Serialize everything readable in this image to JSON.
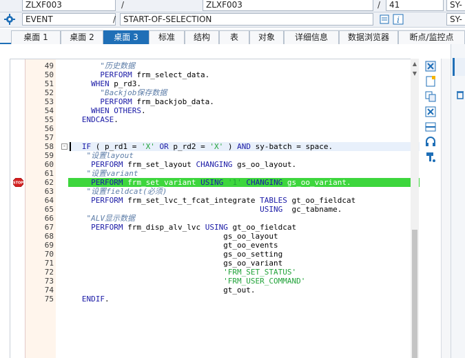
{
  "header": {
    "row1": {
      "program": "ZLXF003",
      "include": "ZLXF003",
      "line": "41",
      "sysvar": "SY-"
    },
    "row2": {
      "event_label": "EVENT",
      "event_value": "START-OF-SELECTION",
      "sysvar": "SY-"
    }
  },
  "tabs": [
    {
      "label": "桌面 1",
      "active": false
    },
    {
      "label": "桌面 2",
      "active": false
    },
    {
      "label": "桌面 3",
      "active": true
    },
    {
      "label": "标准",
      "active": false
    },
    {
      "label": "结构",
      "active": false
    },
    {
      "label": "表",
      "active": false
    },
    {
      "label": "对象",
      "active": false
    },
    {
      "label": "详细信息",
      "active": false
    },
    {
      "label": "数据浏览器",
      "active": false
    },
    {
      "label": "断点/监控点",
      "active": false
    }
  ],
  "editor": {
    "breakpoint_line": 62,
    "current_line": 58,
    "lines": [
      {
        "n": "49",
        "text": "       \"历史数据"
      },
      {
        "n": "50",
        "text": "       PERFORM frm_select_data."
      },
      {
        "n": "51",
        "text": "     WHEN p_rd3."
      },
      {
        "n": "52",
        "text": "       \"Backjob保存数据"
      },
      {
        "n": "53",
        "text": "       PERFORM frm_backjob_data."
      },
      {
        "n": "54",
        "text": "     WHEN OTHERS."
      },
      {
        "n": "55",
        "text": "   ENDCASE."
      },
      {
        "n": "56",
        "text": ""
      },
      {
        "n": "57",
        "text": ""
      },
      {
        "n": "58",
        "text": "   IF ( p_rd1 = 'X' OR p_rd2 = 'X' ) AND sy-batch = space."
      },
      {
        "n": "59",
        "text": "    \"设置layout"
      },
      {
        "n": "60",
        "text": "     PERFORM frm_set_layout CHANGING gs_oo_layout."
      },
      {
        "n": "61",
        "text": "    \"设置variant"
      },
      {
        "n": "62",
        "text": "     PERFORM frm_set_variant USING '1' CHANGING gs_oo_variant."
      },
      {
        "n": "63",
        "text": "    \"设置fieldcat(必须)"
      },
      {
        "n": "64",
        "text": "     PERFORM frm_set_lvc_t_fcat_integrate TABLES gt_oo_fieldcat"
      },
      {
        "n": "65",
        "text": "                                          USING  gc_tabname."
      },
      {
        "n": "66",
        "text": "    \"ALV显示数据"
      },
      {
        "n": "67",
        "text": "     PERFORM frm_disp_alv_lvc USING gt_oo_fieldcat"
      },
      {
        "n": "68",
        "text": "                                  gs_oo_layout"
      },
      {
        "n": "69",
        "text": "                                  gt_oo_events"
      },
      {
        "n": "70",
        "text": "                                  gs_oo_setting"
      },
      {
        "n": "71",
        "text": "                                  gs_oo_variant"
      },
      {
        "n": "72",
        "text": "                                  'FRM_SET_STATUS'"
      },
      {
        "n": "73",
        "text": "                                  'FRM_USER_COMMAND'"
      },
      {
        "n": "74",
        "text": "                                  gt_out."
      },
      {
        "n": "75",
        "text": "   ENDIF."
      }
    ]
  },
  "colors": {
    "accent": "#1f6fb7",
    "exec_line": "#3dd63d",
    "keyword": "#1a1aa6",
    "comment": "#5e7ea8",
    "string": "#22a33a"
  },
  "icons": [
    "gear-icon",
    "stop-breakpoint-icon",
    "info-icon",
    "edit-icon"
  ]
}
